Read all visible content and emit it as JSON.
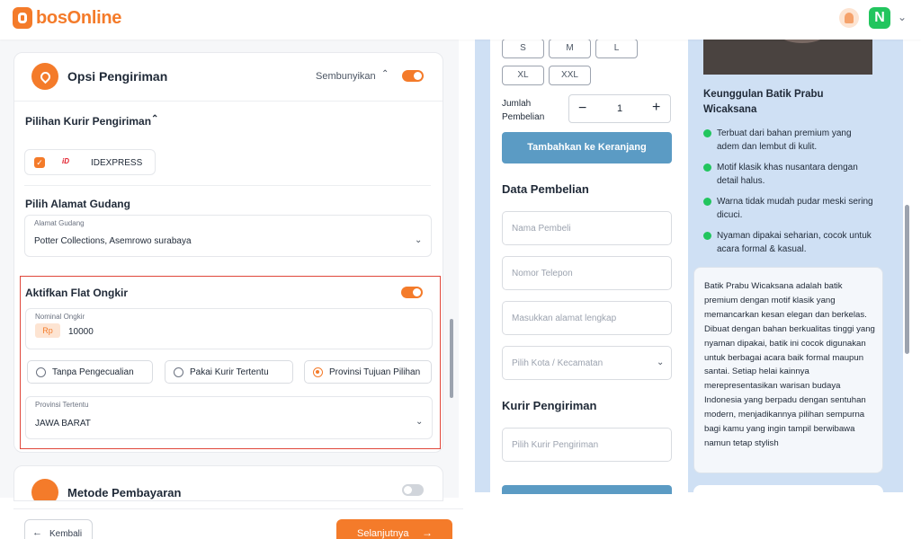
{
  "app": {
    "brand": "bosOnline",
    "avatar_letter": "N"
  },
  "colors": {
    "accent": "#f47b2a",
    "success": "#22c55e",
    "highlight_border": "#e0473b",
    "preview_bg": "#cfe0f4",
    "cta_blue": "#5b9bc4"
  },
  "shipping": {
    "title": "Opsi Pengiriman",
    "hide_label": "Sembunyikan",
    "enabled": true,
    "courier_section": "Pilihan Kurir Pengiriman",
    "courier": {
      "logo_text": "iD",
      "name": "IDEXPRESS",
      "checked": true
    },
    "warehouse_section": "Pilih Alamat Gudang",
    "warehouse_label": "Alamat Gudang",
    "warehouse_value": "Potter Collections, Asemrowo surabaya",
    "flat": {
      "title": "Aktifkan Flat Ongkir",
      "enabled": true,
      "amount_label": "Nominal Ongkir",
      "currency": "Rp",
      "amount": "10000",
      "options": [
        "Tanpa Pengecualian",
        "Pakai Kurir Tertentu",
        "Provinsi Tujuan Pilihan"
      ],
      "selected_option": "Provinsi Tujuan Pilihan",
      "province_label": "Provinsi Tertentu",
      "province_value": "JAWA BARAT"
    }
  },
  "payment": {
    "title": "Metode Pembayaran",
    "enabled": false
  },
  "nav": {
    "back": "Kembali",
    "next": "Selanjutnya"
  },
  "preview": {
    "sizes": [
      "S",
      "M",
      "L",
      "XL",
      "XXL"
    ],
    "qty_label": "Jumlah Pembelian",
    "qty": "1",
    "add_to_cart": "Tambahkan ke Keranjang",
    "purchase_heading": "Data Pembelian",
    "name_placeholder": "Nama Pembeli",
    "phone_placeholder": "Nomor Telepon",
    "address_placeholder": "Masukkan alamat lengkap",
    "city_placeholder": "Pilih Kota / Kecamatan",
    "courier_heading": "Kurir Pengiriman",
    "courier_placeholder": "Pilih Kurir Pengiriman",
    "advantages_title": "Keunggulan Batik Prabu Wicaksana",
    "advantages": [
      "Terbuat dari bahan premium yang adem dan lembut di kulit.",
      "Motif klasik khas nusantara dengan detail halus.",
      "Warna tidak mudah pudar meski sering dicuci.",
      "Nyaman dipakai seharian, cocok untuk acara formal & kasual."
    ],
    "description": "Batik Prabu Wicaksana adalah batik premium dengan motif klasik yang memancarkan kesan elegan dan berkelas. Dibuat dengan bahan berkualitas tinggi yang nyaman dipakai, batik ini cocok digunakan untuk berbagai acara baik formal maupun santai. Setiap helai kainnya merepresentasikan warisan budaya Indonesia yang berpadu dengan sentuhan modern, menjadikannya pilihan sempurna bagi kamu yang ingin tampil berwibawa namun tetap stylish"
  }
}
